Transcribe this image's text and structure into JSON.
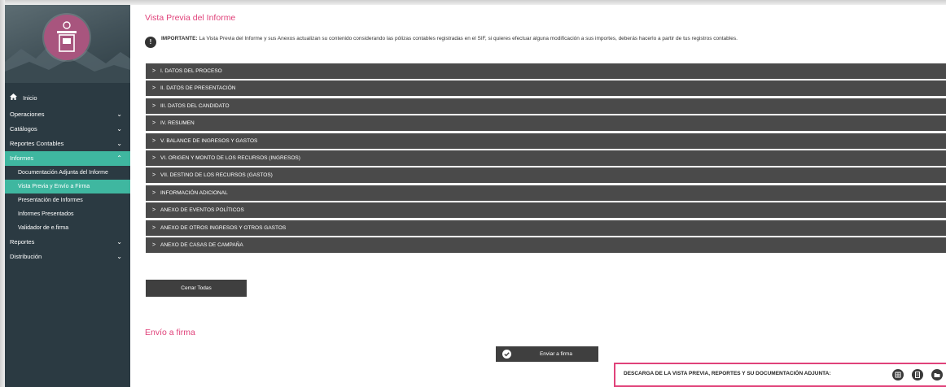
{
  "sidebar": {
    "home_label": "Inicio",
    "items": [
      {
        "label": "Operaciones"
      },
      {
        "label": "Catálogos"
      },
      {
        "label": "Reportes Contables"
      },
      {
        "label": "Informes"
      }
    ],
    "informes_sub": [
      {
        "label": "Documentación Adjunta del Informe"
      },
      {
        "label": "Vista Previa y Envío a Firma"
      },
      {
        "label": "Presentación de Informes"
      },
      {
        "label": "Informes Presentados"
      },
      {
        "label": "Validador de e.firma"
      }
    ],
    "after_items": [
      {
        "label": "Reportes"
      },
      {
        "label": "Distribución"
      }
    ],
    "active_color": "#3fb7a0"
  },
  "main": {
    "title": "Vista Previa del Informe",
    "notice_bold": "IMPORTANTE:",
    "notice_text": " La Vista Previa del Informe y sus Anexos actualizan su contenido considerando las pólizas contables registradas en el SIF, si quieres efectuar alguna modificación a sus importes, deberás hacerlo a partir de tus registros contables.",
    "sections": [
      {
        "label": "I. DATOS DEL PROCESO"
      },
      {
        "label": "II. DATOS DE PRESENTACIÓN"
      },
      {
        "label": "III. DATOS DEL CANDIDATO"
      },
      {
        "label": "IV. RESUMEN"
      },
      {
        "label": "V. BALANCE DE INGRESOS Y GASTOS"
      },
      {
        "label": "VI. ORIGEN Y MONTO DE LOS RECURSOS (INGRESOS)"
      },
      {
        "label": "VII. DESTINO DE LOS RECURSOS (GASTOS)"
      },
      {
        "label": "INFORMACIÓN ADICIONAL"
      },
      {
        "label": "ANEXO DE EVENTOS POLÍTICOS"
      },
      {
        "label": "ANEXO DE OTROS INGRESOS Y OTROS GASTOS"
      },
      {
        "label": "ANEXO DE CASAS DE CAMPAÑA"
      }
    ],
    "close_all_label": "Cerrar Todas",
    "send_section_title": "Envío a firma",
    "send_button_label": "Enviar a firma",
    "download_label": "DESCARGA DE LA VISTA PREVIA, REPORTES Y SU DOCUMENTACIÓN ADJUNTA:",
    "accent_color": "#e0427a"
  }
}
